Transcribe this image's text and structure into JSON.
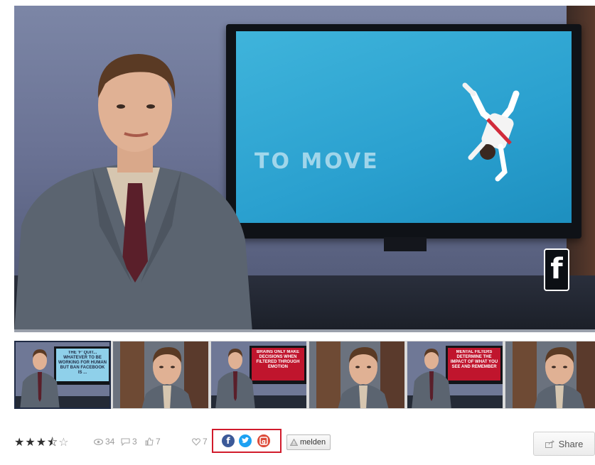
{
  "video": {
    "tv_text": "TO MOVE",
    "badge_letter": "f",
    "progress_fraction": 1.0
  },
  "thumbnails": [
    {
      "id": "thumb-1",
      "caption": "The 'F' quit... whatever to be working for human but ban Facebook is ...",
      "screen_color": "#8fd0ea",
      "text_color": "#1f2a44"
    },
    {
      "id": "thumb-2",
      "caption": "",
      "screen_color": "",
      "text_color": ""
    },
    {
      "id": "thumb-3",
      "caption": "Brains only make decisions when filtered through emotion",
      "screen_color": "#c0152d",
      "text_color": "#ffffff"
    },
    {
      "id": "thumb-4",
      "caption": "",
      "screen_color": "",
      "text_color": ""
    },
    {
      "id": "thumb-5",
      "caption": "Mental filters determine the impact of what you see and remember",
      "screen_color": "#c0152d",
      "text_color": "#ffffff"
    },
    {
      "id": "thumb-6",
      "caption": "",
      "screen_color": "",
      "text_color": ""
    }
  ],
  "rating": {
    "value": 3.5,
    "max": 5
  },
  "stats": {
    "views": "34",
    "comments": "3",
    "likes": "7",
    "favorites": "7"
  },
  "social": {
    "facebook_icon": "facebook-icon",
    "twitter_icon": "twitter-icon",
    "googleplus_icon": "google-plus-icon",
    "highlight_color": "#d11b2c"
  },
  "report_label": "melden",
  "share_label": "Share"
}
